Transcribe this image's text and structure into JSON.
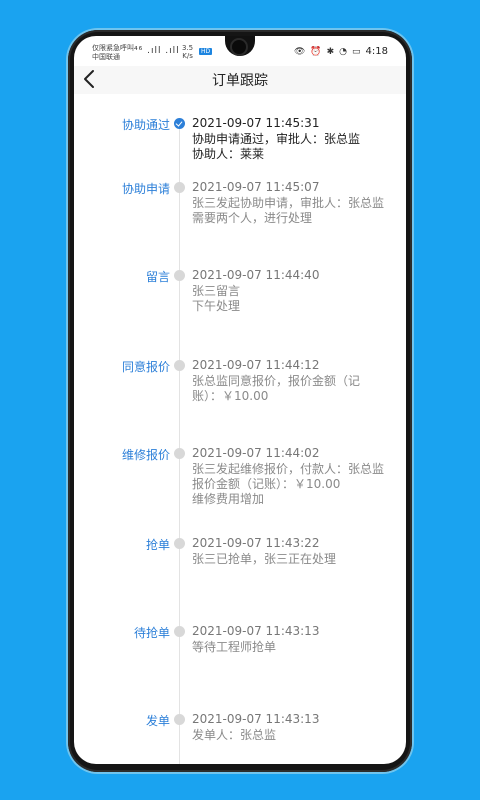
{
  "status_bar": {
    "carrier_line1": "仅限紧急呼叫",
    "carrier_line2": "中国联通",
    "signal": "⁴⁶ .ıll .ıll",
    "net_speed_value": "3.5",
    "net_speed_unit": "K/s",
    "hd_badge": "HD",
    "time": "4:18"
  },
  "header": {
    "title": "订单跟踪"
  },
  "timeline": [
    {
      "label": "协助通过",
      "time": "2021-09-07 11:45:31",
      "desc": "协助申请通过，审批人：张总监\n协助人：莱莱",
      "current": true
    },
    {
      "label": "协助申请",
      "time": "2021-09-07 11:45:07",
      "desc": "张三发起协助申请，审批人：张总监\n需要两个人，进行处理",
      "current": false
    },
    {
      "label": "留言",
      "time": "2021-09-07 11:44:40",
      "desc": "张三留言\n下午处理",
      "current": false
    },
    {
      "label": "同意报价",
      "time": "2021-09-07 11:44:12",
      "desc": "张总监同意报价，报价金额（记\n账）：￥10.00",
      "current": false
    },
    {
      "label": "维修报价",
      "time": "2021-09-07 11:44:02",
      "desc": "张三发起维修报价，付款人：张总监\n报价金额（记账）：￥10.00\n维修费用增加",
      "current": false
    },
    {
      "label": "抢单",
      "time": "2021-09-07 11:43:22",
      "desc": "张三已抢单，张三正在处理",
      "current": false
    },
    {
      "label": "待抢单",
      "time": "2021-09-07 11:43:13",
      "desc": "等待工程师抢单",
      "current": false
    },
    {
      "label": "发单",
      "time": "2021-09-07 11:43:13",
      "desc": "发单人：张总监",
      "current": false
    }
  ]
}
